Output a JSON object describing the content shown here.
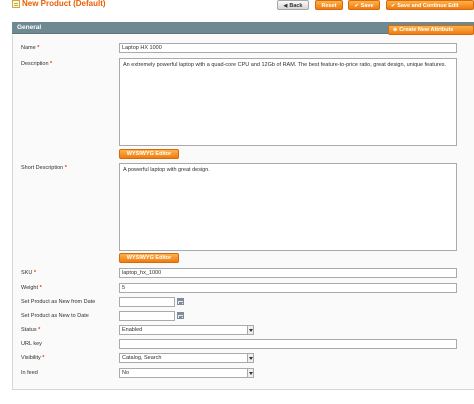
{
  "header": {
    "title": "New Product (Default)",
    "buttons": {
      "back": "Back",
      "reset": "Reset",
      "save": "Save",
      "save_continue": "Save and Continue Edit"
    }
  },
  "section": {
    "title": "General",
    "create_attribute": "Create New Attribute"
  },
  "fields": {
    "name": {
      "label": "Name",
      "required": "*",
      "value": "Laptop HX 1000"
    },
    "description": {
      "label": "Description",
      "required": "*",
      "value": "An extremely powerful laptop with a quad-core CPU and 12Gb of RAM. The best feature-to-price ratio, great design, unique features."
    },
    "short_description": {
      "label": "Short Description",
      "required": "*",
      "value": "A powerful laptop with great design."
    },
    "wysiwyg_label": "WYSIWYG Editor",
    "sku": {
      "label": "SKU",
      "required": "*",
      "value": "laptop_hx_1000"
    },
    "weight": {
      "label": "Weight",
      "required": "*",
      "value": "5"
    },
    "new_from": {
      "label": "Set Product as New from Date",
      "value": ""
    },
    "new_to": {
      "label": "Set Product as New to Date",
      "value": ""
    },
    "status": {
      "label": "Status",
      "required": "*",
      "value": "Enabled"
    },
    "url_key": {
      "label": "URL key",
      "value": ""
    },
    "visibility": {
      "label": "Visibility",
      "required": "*",
      "value": "Catalog, Search"
    },
    "in_feed": {
      "label": "In feed",
      "value": "No"
    }
  },
  "colors": {
    "accent": "#eb5e00",
    "section_header": "#6f8992",
    "required": "#eb340a"
  },
  "icons": {
    "page": "page-icon",
    "calendar": "calendar-icon",
    "back": "back-arrow-icon",
    "save": "save-icon",
    "add": "add-icon"
  }
}
